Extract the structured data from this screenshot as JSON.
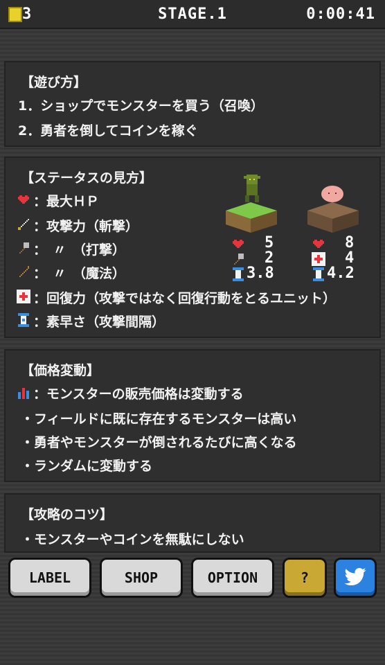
{
  "header": {
    "coins": "3",
    "stage": "STAGE.1",
    "timer": "0:00:41"
  },
  "how_to_play": {
    "title": "【遊び方】",
    "lines": [
      "1．ショップでモンスターを買う（召喚）",
      "2．勇者を倒してコインを稼ぐ"
    ]
  },
  "status": {
    "title": "【ステータスの見方】",
    "rows": [
      {
        "icon": "heart-icon",
        "text": "：最大ＨＰ"
      },
      {
        "icon": "sword-icon",
        "text": "：攻撃力（斬撃）"
      },
      {
        "icon": "hammer-icon",
        "text": "：　〃　（打撃）"
      },
      {
        "icon": "staff-icon",
        "text": "：　〃　（魔法）"
      },
      {
        "icon": "heal-icon",
        "text": "：回復力（攻撃ではなく回復行動をとるユニット）"
      },
      {
        "icon": "hourglass-icon",
        "text": "：素早さ（攻撃間隔）"
      }
    ],
    "unit_a": {
      "hp": "5",
      "attack": "2",
      "speed": "3.8"
    },
    "unit_b": {
      "hp": "8",
      "heal": "4",
      "speed": "4.2"
    }
  },
  "price": {
    "title": "【価格変動】",
    "lines": [
      "：モンスターの販売価格は変動する",
      "・フィールドに既に存在するモンスターは高い",
      "・勇者やモンスターが倒されるたびに高くなる",
      "・ランダムに変動する"
    ]
  },
  "tips": {
    "title": "【攻略のコツ】",
    "lines": [
      "・モンスターやコインを無駄にしない"
    ]
  },
  "buttons": {
    "label": "LABEL",
    "shop": "SHOP",
    "option": "OPTION",
    "help": "?"
  },
  "colors": {
    "heart": "#e8343c",
    "gold": "#c9a934",
    "twitter": "#2b82e0"
  }
}
